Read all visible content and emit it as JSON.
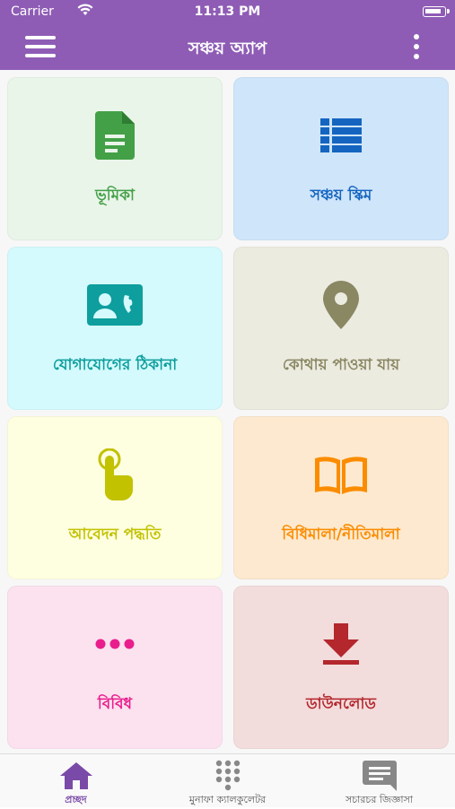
{
  "status": {
    "carrier": "Carrier",
    "time": "11:13 PM"
  },
  "header": {
    "title": "সঞ্চয় অ্যাপ"
  },
  "tiles": [
    {
      "label": "ভূমিকা",
      "icon": "document-icon",
      "bg": "#eaf5e9",
      "color": "#43a047"
    },
    {
      "label": "সঞ্চয় স্কিম",
      "icon": "list-icon",
      "bg": "#cfe5fa",
      "color": "#1565c0"
    },
    {
      "label": "যোগাযোগের ঠিকানা",
      "icon": "contact-icon",
      "bg": "#d4fafd",
      "color": "#0e9e9e"
    },
    {
      "label": "কোথায় পাওয়া যায়",
      "icon": "location-pin-icon",
      "bg": "#ecebe0",
      "color": "#8a8763"
    },
    {
      "label": "আবেদন পদ্ধতি",
      "icon": "touch-hand-icon",
      "bg": "#fefee1",
      "color": "#c2c200"
    },
    {
      "label": "বিধিমালা/নীতিমালা",
      "icon": "book-icon",
      "bg": "#fde9cf",
      "color": "#fb8c00"
    },
    {
      "label": "বিবিধ",
      "icon": "more-dots-icon",
      "bg": "#fce1ef",
      "color": "#e91e8c"
    },
    {
      "label": "ডাউনলোড",
      "icon": "download-icon",
      "bg": "#f3dcdc",
      "color": "#b3272d"
    }
  ],
  "tabs": [
    {
      "label": "প্রচ্ছদ",
      "icon": "home-icon",
      "active": true
    },
    {
      "label": "মুনাফা ক্যালকুলেটর",
      "icon": "dialpad-icon",
      "active": false
    },
    {
      "label": "সচারচর জিজ্ঞাসা",
      "icon": "chat-icon",
      "active": false
    }
  ]
}
